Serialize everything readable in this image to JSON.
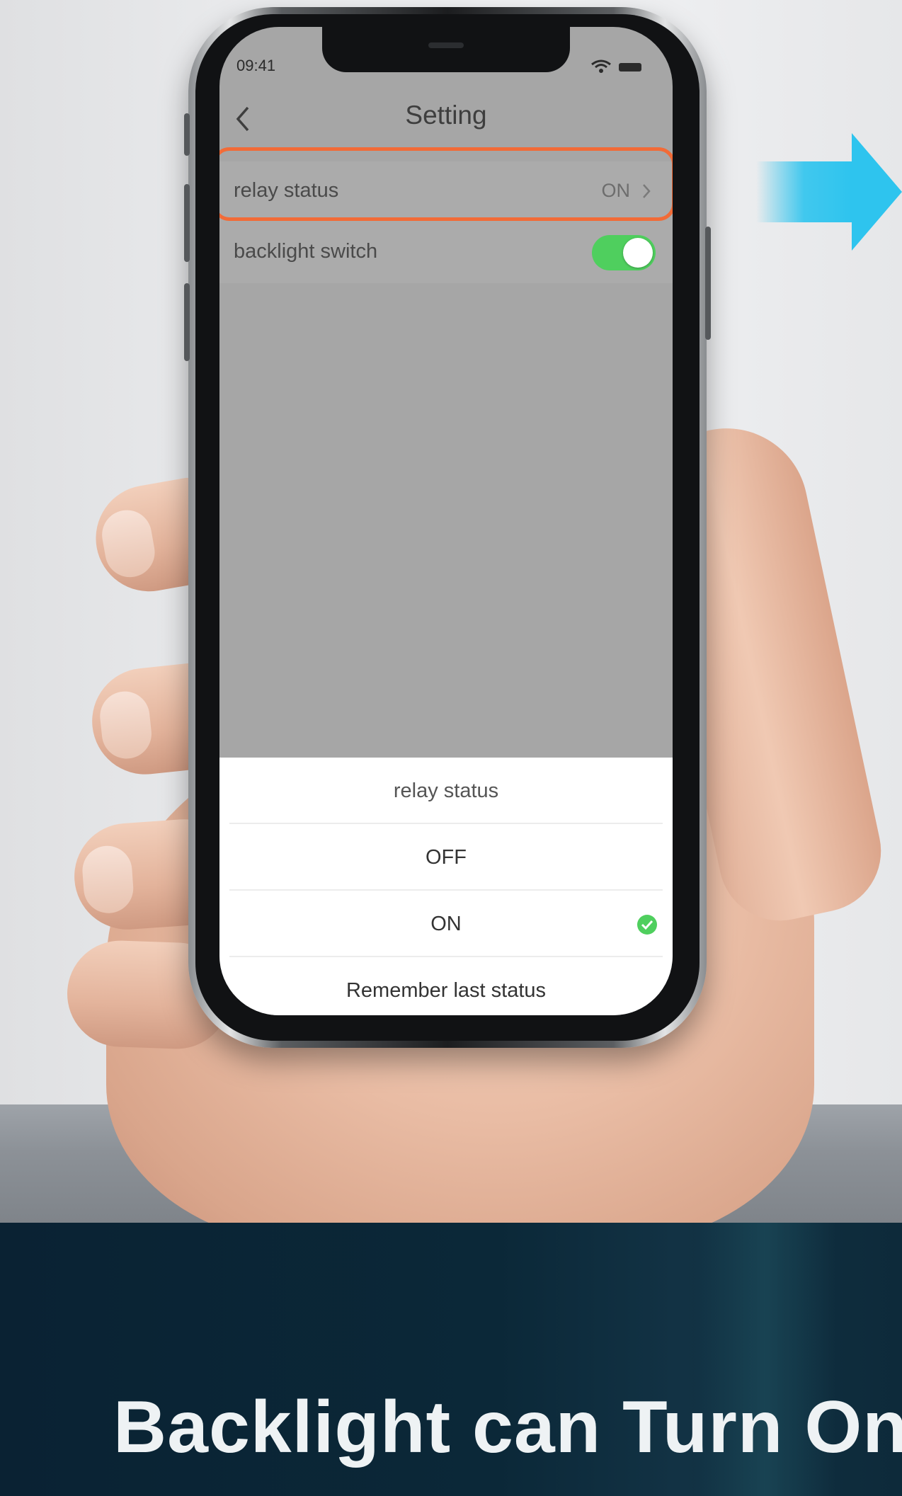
{
  "status_bar": {
    "time": "09:41"
  },
  "navbar": {
    "title": "Setting"
  },
  "settings": {
    "relay": {
      "label": "relay status",
      "value": "ON"
    },
    "backlight": {
      "label": "backlight switch",
      "enabled": true
    }
  },
  "sheet": {
    "title": "relay status",
    "options": [
      "OFF",
      "ON",
      "Remember last status"
    ],
    "selected": "ON"
  },
  "banner": {
    "text": "Backlight can Turn On"
  },
  "colors": {
    "highlight": "#f26b37",
    "toggle_on": "#4fcf5e",
    "check": "#4fcf5e",
    "arrow": "#2ec4ee",
    "banner_bg": "#0b2838"
  },
  "icons": [
    "back-icon",
    "chevron-right-icon",
    "wifi-icon",
    "battery-icon",
    "check-icon",
    "arrow-right-icon"
  ]
}
